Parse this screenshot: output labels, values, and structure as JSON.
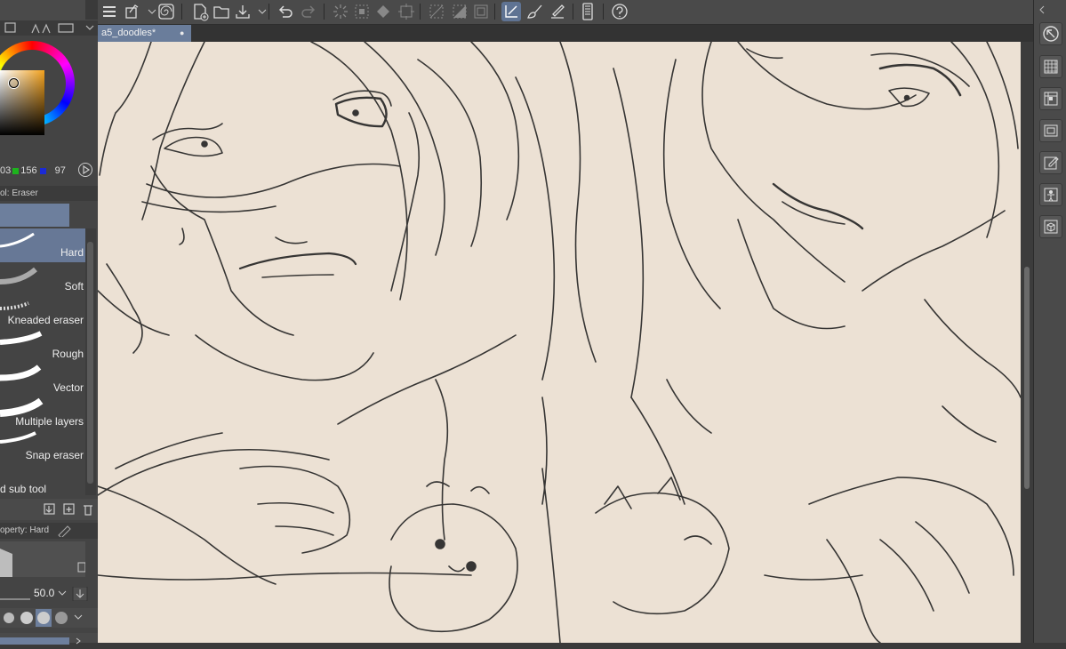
{
  "document": {
    "tab_title": "a5_doodles*",
    "tab_close": "●"
  },
  "color": {
    "r": "03",
    "g": "156",
    "b": "97"
  },
  "subtool": {
    "header": "ol: Eraser",
    "footer_label": "d sub tool"
  },
  "brushes": [
    {
      "label": "Hard",
      "selected": true
    },
    {
      "label": "Soft",
      "selected": false
    },
    {
      "label": "Kneaded eraser",
      "selected": false
    },
    {
      "label": "Rough",
      "selected": false
    },
    {
      "label": "Vector",
      "selected": false
    },
    {
      "label": "Multiple layers",
      "selected": false
    },
    {
      "label": "Snap eraser",
      "selected": false
    }
  ],
  "tool_property": {
    "header": "operty: Hard",
    "size": "50.0"
  },
  "colors": {
    "toolbar_bg": "#4a4a4a",
    "accent": "#6a7d9b",
    "canvas": "#ece1d4",
    "ink": "#1a1a1a"
  },
  "toolbar_icons": [
    "menu-icon",
    "transform-icon",
    "chevron-down-icon",
    "spiral-icon",
    "new-file-icon",
    "open-folder-icon",
    "save-icon",
    "chevron-down-icon",
    "undo-icon",
    "redo-icon",
    "clear-icon",
    "select-all-icon",
    "fill-icon",
    "crop-icon",
    "deselect-icon",
    "invert-selection-icon",
    "frame-icon",
    "ruler-snap-icon",
    "brush-snap-icon",
    "pen-snap-icon",
    "tablet-icon",
    "help-icon"
  ],
  "right_dock_icons": [
    "navigator-icon",
    "grid-icon",
    "material-icon",
    "layer-icon",
    "edit-icon",
    "figure-icon",
    "3d-icon"
  ]
}
